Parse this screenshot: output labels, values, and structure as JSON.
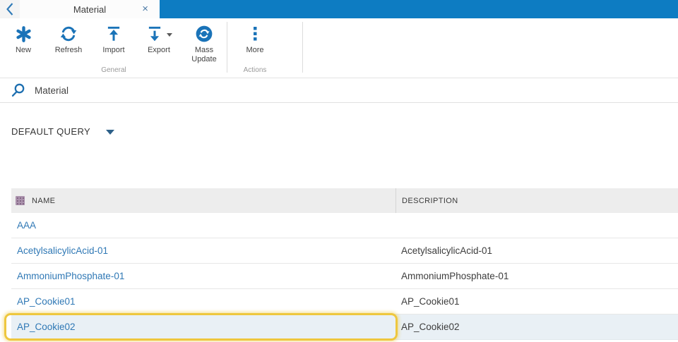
{
  "tab_bar": {
    "tab_title": "Material",
    "close_glyph": "×"
  },
  "toolbar": {
    "buttons": [
      {
        "label": "New",
        "icon": "new-asterisk-icon"
      },
      {
        "label": "Refresh",
        "icon": "refresh-icon"
      },
      {
        "label": "Import",
        "icon": "import-icon"
      },
      {
        "label": "Export",
        "icon": "export-icon",
        "has_dropdown": true
      },
      {
        "label": "Mass Update",
        "icon": "mass-update-icon"
      },
      {
        "label": "More",
        "icon": "more-icon"
      }
    ],
    "groups": [
      {
        "label": "General"
      },
      {
        "label": "Actions"
      }
    ]
  },
  "search": {
    "value": "Material",
    "icon": "search-icon"
  },
  "query_selector": {
    "label": "DEFAULT QUERY"
  },
  "table": {
    "columns": [
      "NAME",
      "DESCRIPTION"
    ],
    "rows": [
      {
        "name": "AAA",
        "description": "",
        "highlighted": false
      },
      {
        "name": "AcetylsalicylicAcid-01",
        "description": "AcetylsalicylicAcid-01",
        "highlighted": false
      },
      {
        "name": "AmmoniumPhosphate-01",
        "description": "AmmoniumPhosphate-01",
        "highlighted": false
      },
      {
        "name": "AP_Cookie01",
        "description": "AP_Cookie01",
        "highlighted": false
      },
      {
        "name": "AP_Cookie02",
        "description": "AP_Cookie02",
        "highlighted": true
      }
    ]
  },
  "colors": {
    "accent_blue": "#0d7cc2",
    "icon_blue": "#1a73b8",
    "link_blue": "#2f78b5",
    "highlight_border": "#eec73e",
    "highlight_row_bg": "#e9f0f5",
    "header_bg": "#ededed",
    "column_icon_mauve": "#ab92ad"
  }
}
